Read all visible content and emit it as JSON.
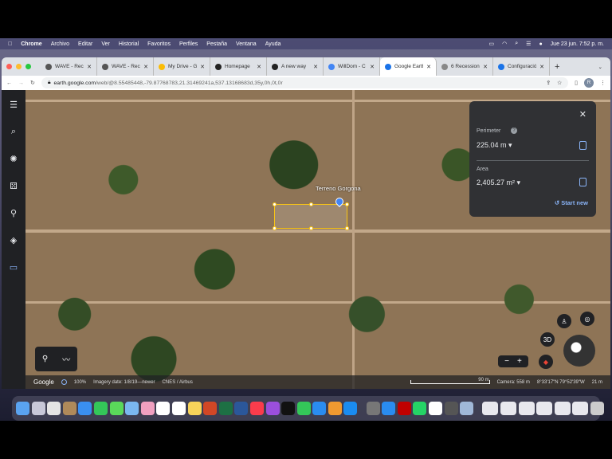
{
  "menubar": {
    "app": "Chrome",
    "items": [
      "Archivo",
      "Editar",
      "Ver",
      "Historial",
      "Favoritos",
      "Perfiles",
      "Pestaña",
      "Ventana",
      "Ayuda"
    ],
    "datetime": "Jue 23 jun.  7:52 p. m."
  },
  "tabs": [
    {
      "label": "WAVE - Rec",
      "color": "#555"
    },
    {
      "label": "WAVE - Rec",
      "color": "#555"
    },
    {
      "label": "My Drive - G",
      "color": "#fbbc04"
    },
    {
      "label": "Homepage",
      "color": "#222"
    },
    {
      "label": "A new way",
      "color": "#222"
    },
    {
      "label": "WillDom - C",
      "color": "#4285f4"
    },
    {
      "label": "Google Earth",
      "color": "#1a73e8",
      "active": true
    },
    {
      "label": "6 Recession",
      "color": "#888"
    },
    {
      "label": "Configuració",
      "color": "#1a73e8"
    }
  ],
  "address": {
    "host": "earth.google.com",
    "path": "/web/@8.55485448,-79.87768783,21.31469241a,537.13168683d,35y,0h,0t,0r",
    "avatar": "R"
  },
  "map": {
    "placemark_label": "Terreno Gorgona"
  },
  "measure_panel": {
    "perimeter_label": "Perimeter",
    "perimeter_value": "225.04 m",
    "area_label": "Area",
    "area_value": "2,405.27 m²",
    "start_new": "Start new"
  },
  "controls": {
    "three_d": "3D",
    "zoom_out": "−",
    "zoom_in": "+"
  },
  "status": {
    "brand": "Google",
    "zoom": "100%",
    "imagery_date": "Imagery date: 1/8/19—newer",
    "credits": "CNES / Airbus",
    "scale": "90 m",
    "camera": "Camera: 558 m",
    "coords": "8°33'17\"N 79°52'39\"W",
    "elevation": "21 m"
  },
  "dock_colors": [
    "#5aa3f0",
    "#c8c8d8",
    "#e5e5e5",
    "#b08a5a",
    "#3a8ff0",
    "#34c759",
    "#5ad85a",
    "#7ab7f0",
    "#f0a0c0",
    "#ffffff",
    "#ffffff",
    "#f7d35a",
    "#d24726",
    "#1d7044",
    "#2b579a",
    "#fa3c4c",
    "#9b4fdc",
    "#111111",
    "#34c759",
    "#2a8cf0",
    "#f09a30",
    "#1a8cf0",
    "#777777",
    "#2a8cf0",
    "#c00000",
    "#25d366",
    "#ffffff",
    "#555555",
    "#a0b8d8"
  ],
  "dock_windows": 6
}
